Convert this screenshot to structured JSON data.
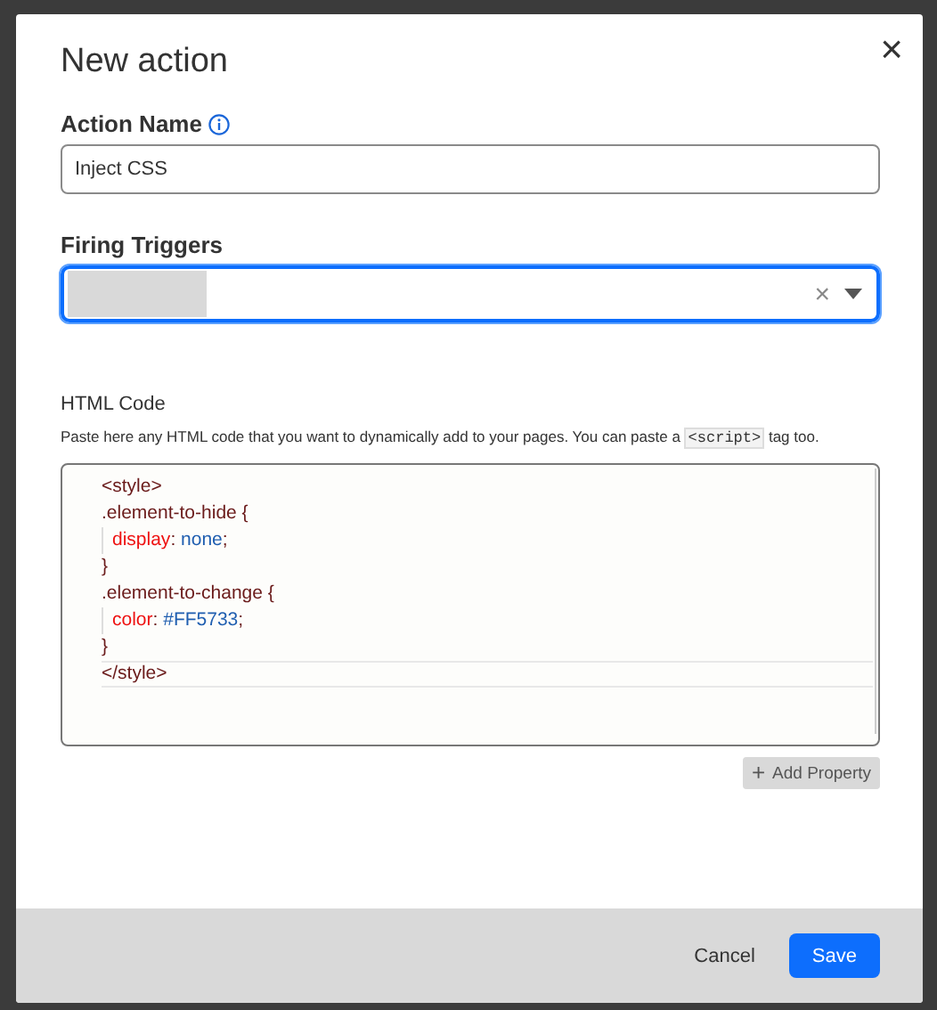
{
  "dialog": {
    "title": "New action",
    "close": "×"
  },
  "action_name": {
    "label": "Action Name",
    "value": "Inject CSS"
  },
  "firing_triggers": {
    "label": "Firing Triggers",
    "focused": true,
    "clear": "×"
  },
  "html_code": {
    "label": "HTML Code",
    "description": [
      {
        "kind": "text",
        "text": "Paste here any HTML code that you want to dynamically add to your pages. You can paste a "
      },
      {
        "kind": "code",
        "text": "<script>"
      },
      {
        "kind": "text",
        "text": " tag too."
      }
    ],
    "lines": [
      {
        "indented": false,
        "active": false,
        "tokens": [
          {
            "kind": "tag",
            "text": "<style>"
          }
        ]
      },
      {
        "indented": false,
        "active": false,
        "tokens": [
          {
            "kind": "selector",
            "text": ".element-to-hide"
          },
          {
            "kind": "punct",
            "text": " {"
          }
        ]
      },
      {
        "indented": true,
        "active": false,
        "tokens": [
          {
            "kind": "property",
            "text": "display"
          },
          {
            "kind": "punct",
            "text": ": "
          },
          {
            "kind": "value",
            "text": "none"
          },
          {
            "kind": "punct",
            "text": ";"
          }
        ]
      },
      {
        "indented": false,
        "active": false,
        "tokens": [
          {
            "kind": "punct",
            "text": "}"
          }
        ]
      },
      {
        "indented": false,
        "active": false,
        "tokens": [
          {
            "kind": "selector",
            "text": ".element-to-change"
          },
          {
            "kind": "punct",
            "text": " {"
          }
        ]
      },
      {
        "indented": true,
        "active": false,
        "tokens": [
          {
            "kind": "property",
            "text": "color"
          },
          {
            "kind": "punct",
            "text": ": "
          },
          {
            "kind": "value",
            "text": "#FF5733"
          },
          {
            "kind": "punct",
            "text": ";"
          }
        ]
      },
      {
        "indented": false,
        "active": false,
        "tokens": [
          {
            "kind": "punct",
            "text": "}"
          }
        ]
      },
      {
        "indented": false,
        "active": true,
        "tokens": [
          {
            "kind": "tag",
            "text": "</style>"
          }
        ]
      }
    ]
  },
  "add_property": {
    "icon": "+",
    "label": "Add Property"
  },
  "buttons": [
    {
      "label": "Cancel",
      "kind": "secondary"
    },
    {
      "label": "Save",
      "kind": "primary"
    }
  ]
}
